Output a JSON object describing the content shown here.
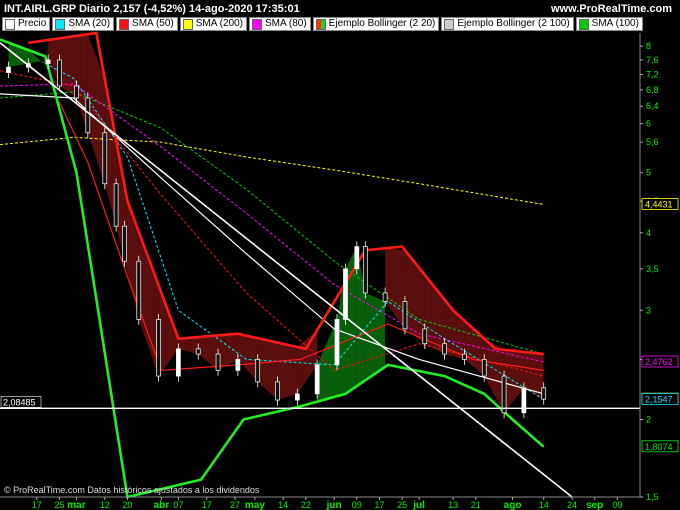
{
  "header": {
    "title": "INT.AIRL.GRP Diario 2,157 (-4,52%) 14-ago-2020 17:35:01",
    "site": "www.ProRealTime.com"
  },
  "legend": [
    {
      "label": "Precio",
      "color": "#ffffff",
      "icon": "box-swatch"
    },
    {
      "label": "SMA (20)",
      "color": "#00e5ff",
      "icon": "box-swatch"
    },
    {
      "label": "SMA (50)",
      "color": "#ff1111",
      "icon": "box-swatch"
    },
    {
      "label": "SMA (200)",
      "color": "#ffff00",
      "icon": "box-swatch"
    },
    {
      "label": "SMA (80)",
      "color": "#ff00ff",
      "icon": "box-swatch"
    },
    {
      "label": "Ejemplo Bollinger (2 20)",
      "color": "#ff3300",
      "icon": "split-swatch-red-green"
    },
    {
      "label": "Ejemplo Bollinger (2 100)",
      "color": "#cccccc",
      "icon": "box-swatch"
    },
    {
      "label": "SMA (100)",
      "color": "#00cc00",
      "icon": "box-swatch"
    }
  ],
  "footer": "© ProRealTime.com  Datos históricos ajustados a los dividendos",
  "colors": {
    "background": "#000000",
    "up_fill": "#0a6f0a",
    "down_fill": "#6b1010",
    "band_red": "#ff1a1a",
    "band_green": "#22ee22",
    "trendline": "#ffffff"
  },
  "chart_data": {
    "type": "candlestick",
    "scale": "log",
    "grid": false,
    "ylim": [
      1.5,
      8.4
    ],
    "y_ticks": [
      8,
      7.6,
      7.2,
      6.8,
      6.4,
      6,
      5.6,
      5,
      4.5,
      4,
      3.5,
      3,
      2.5,
      2,
      1.5
    ],
    "y_tick_labels": [
      "8",
      "7,6",
      "7,2",
      "6,8",
      "6,4",
      "6",
      "5,6",
      "5",
      "4,5",
      "4",
      "3,5",
      "3",
      "2,5",
      "2",
      "1,5"
    ],
    "x_ticks": [
      {
        "label": "17",
        "date": "2020-02-17"
      },
      {
        "label": "25",
        "date": "2020-02-25"
      },
      {
        "label": "mar",
        "date": "2020-03-02",
        "month": true
      },
      {
        "label": "12",
        "date": "2020-03-12"
      },
      {
        "label": "20",
        "date": "2020-03-20"
      },
      {
        "label": "abr",
        "date": "2020-04-01",
        "month": true
      },
      {
        "label": "07",
        "date": "2020-04-07"
      },
      {
        "label": "17",
        "date": "2020-04-17"
      },
      {
        "label": "27",
        "date": "2020-04-27"
      },
      {
        "label": "may",
        "date": "2020-05-04",
        "month": true
      },
      {
        "label": "14",
        "date": "2020-05-14"
      },
      {
        "label": "22",
        "date": "2020-05-22"
      },
      {
        "label": "jun",
        "date": "2020-06-01",
        "month": true
      },
      {
        "label": "09",
        "date": "2020-06-09"
      },
      {
        "label": "17",
        "date": "2020-06-17"
      },
      {
        "label": "25",
        "date": "2020-06-25"
      },
      {
        "label": "jul",
        "date": "2020-07-01",
        "month": true
      },
      {
        "label": "13",
        "date": "2020-07-13"
      },
      {
        "label": "21",
        "date": "2020-07-21"
      },
      {
        "label": "ago",
        "date": "2020-08-03",
        "month": true
      },
      {
        "label": "14",
        "date": "2020-08-14"
      },
      {
        "label": "24",
        "date": "2020-08-24"
      },
      {
        "label": "sep",
        "date": "2020-09-01",
        "month": true
      },
      {
        "label": "09",
        "date": "2020-09-09"
      }
    ],
    "price_labels": [
      {
        "value": 4.4431,
        "text": "4,4431",
        "color": "#ffff00"
      },
      {
        "value": 2.4762,
        "text": "2,4762",
        "color": "#ff00ff"
      },
      {
        "value": 2.157,
        "text": "2,157",
        "color": "#ffff00"
      },
      {
        "value": 2.1547,
        "text": "2,1547",
        "color": "#00e5ff"
      },
      {
        "value": 1.8074,
        "text": "1,8074",
        "color": "#00ee00"
      }
    ],
    "horizontal_line": {
      "value": 2.08485,
      "text": "2,08485"
    },
    "trendline": {
      "start": {
        "date": "2020-02-04",
        "value": 8.1
      },
      "end": {
        "date": "2020-08-24",
        "value": 1.5
      }
    },
    "close": [
      {
        "date": "2020-02-07",
        "value": 7.4
      },
      {
        "date": "2020-02-14",
        "value": 7.5
      },
      {
        "date": "2020-02-21",
        "value": 7.6
      },
      {
        "date": "2020-02-25",
        "value": 6.9
      },
      {
        "date": "2020-03-02",
        "value": 6.6
      },
      {
        "date": "2020-03-06",
        "value": 5.8
      },
      {
        "date": "2020-03-12",
        "value": 4.8
      },
      {
        "date": "2020-03-16",
        "value": 4.1
      },
      {
        "date": "2020-03-19",
        "value": 3.6
      },
      {
        "date": "2020-03-24",
        "value": 2.9
      },
      {
        "date": "2020-03-31",
        "value": 2.35
      },
      {
        "date": "2020-04-07",
        "value": 2.6
      },
      {
        "date": "2020-04-14",
        "value": 2.55
      },
      {
        "date": "2020-04-21",
        "value": 2.4
      },
      {
        "date": "2020-04-28",
        "value": 2.5
      },
      {
        "date": "2020-05-05",
        "value": 2.3
      },
      {
        "date": "2020-05-12",
        "value": 2.15
      },
      {
        "date": "2020-05-19",
        "value": 2.2
      },
      {
        "date": "2020-05-26",
        "value": 2.45
      },
      {
        "date": "2020-06-02",
        "value": 2.9
      },
      {
        "date": "2020-06-05",
        "value": 3.5
      },
      {
        "date": "2020-06-09",
        "value": 3.8
      },
      {
        "date": "2020-06-12",
        "value": 3.2
      },
      {
        "date": "2020-06-19",
        "value": 3.1
      },
      {
        "date": "2020-06-26",
        "value": 2.8
      },
      {
        "date": "2020-07-03",
        "value": 2.65
      },
      {
        "date": "2020-07-10",
        "value": 2.55
      },
      {
        "date": "2020-07-17",
        "value": 2.5
      },
      {
        "date": "2020-07-24",
        "value": 2.35
      },
      {
        "date": "2020-07-31",
        "value": 2.05
      },
      {
        "date": "2020-08-07",
        "value": 2.25
      },
      {
        "date": "2020-08-14",
        "value": 2.157
      }
    ],
    "series": [
      {
        "name": "SMA (200)",
        "color": "#ffff00",
        "dash": true,
        "values": [
          {
            "date": "2020-02-04",
            "value": 5.55
          },
          {
            "date": "2020-03-01",
            "value": 5.7
          },
          {
            "date": "2020-04-01",
            "value": 5.6
          },
          {
            "date": "2020-05-01",
            "value": 5.3
          },
          {
            "date": "2020-06-01",
            "value": 5.05
          },
          {
            "date": "2020-07-01",
            "value": 4.8
          },
          {
            "date": "2020-08-14",
            "value": 4.4431
          }
        ]
      },
      {
        "name": "SMA (100)",
        "color": "#00cc00",
        "dash": true,
        "values": [
          {
            "date": "2020-02-04",
            "value": 6.6
          },
          {
            "date": "2020-03-01",
            "value": 6.75
          },
          {
            "date": "2020-04-01",
            "value": 5.9
          },
          {
            "date": "2020-05-01",
            "value": 4.7
          },
          {
            "date": "2020-06-01",
            "value": 3.6
          },
          {
            "date": "2020-07-01",
            "value": 2.9
          },
          {
            "date": "2020-08-14",
            "value": 2.55
          }
        ]
      },
      {
        "name": "SMA (80)",
        "color": "#ff00ff",
        "dash": true,
        "values": [
          {
            "date": "2020-02-04",
            "value": 6.9
          },
          {
            "date": "2020-03-01",
            "value": 6.95
          },
          {
            "date": "2020-04-01",
            "value": 5.5
          },
          {
            "date": "2020-05-01",
            "value": 4.3
          },
          {
            "date": "2020-06-01",
            "value": 3.3
          },
          {
            "date": "2020-07-01",
            "value": 2.75
          },
          {
            "date": "2020-08-14",
            "value": 2.4762
          }
        ]
      },
      {
        "name": "SMA (50)",
        "color": "#ff1111",
        "dash": true,
        "values": [
          {
            "date": "2020-02-04",
            "value": 7.3
          },
          {
            "date": "2020-03-01",
            "value": 6.9
          },
          {
            "date": "2020-04-01",
            "value": 4.6
          },
          {
            "date": "2020-05-01",
            "value": 3.2
          },
          {
            "date": "2020-06-01",
            "value": 2.4
          },
          {
            "date": "2020-07-01",
            "value": 2.65
          },
          {
            "date": "2020-08-14",
            "value": 2.35
          }
        ]
      },
      {
        "name": "SMA (20)",
        "color": "#00e5ff",
        "dash": true,
        "values": [
          {
            "date": "2020-02-20",
            "value": 7.5
          },
          {
            "date": "2020-03-01",
            "value": 7.1
          },
          {
            "date": "2020-03-20",
            "value": 5.3
          },
          {
            "date": "2020-04-07",
            "value": 3.0
          },
          {
            "date": "2020-05-01",
            "value": 2.5
          },
          {
            "date": "2020-06-01",
            "value": 2.45
          },
          {
            "date": "2020-06-20",
            "value": 3.1
          },
          {
            "date": "2020-07-10",
            "value": 2.7
          },
          {
            "date": "2020-08-14",
            "value": 2.1547
          }
        ]
      },
      {
        "name": "Ejemplo Bollinger (2 100)",
        "color": "#ffffff",
        "dash": false,
        "values": [
          {
            "date": "2020-02-04",
            "value": 6.7
          },
          {
            "date": "2020-03-01",
            "value": 6.6
          },
          {
            "date": "2020-04-01",
            "value": 4.9
          },
          {
            "date": "2020-05-01",
            "value": 3.7
          },
          {
            "date": "2020-06-01",
            "value": 2.8
          },
          {
            "date": "2020-07-01",
            "value": 2.5
          },
          {
            "date": "2020-08-14",
            "value": 2.2
          }
        ]
      },
      {
        "name": "Ejemplo Bollinger (2 20)",
        "color": "#ff1a1a",
        "dash": false,
        "values": [
          {
            "date": "2020-02-25",
            "value": 6.5
          },
          {
            "date": "2020-03-06",
            "value": 5.2
          },
          {
            "date": "2020-03-20",
            "value": 3.4
          },
          {
            "date": "2020-04-01",
            "value": 2.4
          },
          {
            "date": "2020-04-28",
            "value": 2.45
          },
          {
            "date": "2020-05-20",
            "value": 2.5
          },
          {
            "date": "2020-06-20",
            "value": 2.85
          },
          {
            "date": "2020-07-20",
            "value": 2.5
          },
          {
            "date": "2020-08-14",
            "value": 2.4
          }
        ]
      }
    ],
    "bollinger_20": {
      "upper_color": "#ff1a1a",
      "lower_color": "#22ee22",
      "upper": [
        {
          "date": "2020-02-14",
          "value": 8.1
        },
        {
          "date": "2020-03-09",
          "value": 8.4
        },
        {
          "date": "2020-03-20",
          "value": 4.5
        },
        {
          "date": "2020-04-07",
          "value": 2.7
        },
        {
          "date": "2020-04-28",
          "value": 2.75
        },
        {
          "date": "2020-05-22",
          "value": 2.6
        },
        {
          "date": "2020-06-12",
          "value": 3.75
        },
        {
          "date": "2020-06-25",
          "value": 3.8
        },
        {
          "date": "2020-07-13",
          "value": 3.0
        },
        {
          "date": "2020-07-28",
          "value": 2.6
        },
        {
          "date": "2020-08-14",
          "value": 2.55
        }
      ],
      "lower": [
        {
          "date": "2020-02-04",
          "value": 8.2
        },
        {
          "date": "2020-02-20",
          "value": 7.7
        },
        {
          "date": "2020-03-02",
          "value": 5.0
        },
        {
          "date": "2020-03-20",
          "value": 1.5
        },
        {
          "date": "2020-04-15",
          "value": 1.6
        },
        {
          "date": "2020-04-30",
          "value": 2.0
        },
        {
          "date": "2020-05-20",
          "value": 2.1
        },
        {
          "date": "2020-06-05",
          "value": 2.2
        },
        {
          "date": "2020-06-20",
          "value": 2.45
        },
        {
          "date": "2020-07-10",
          "value": 2.35
        },
        {
          "date": "2020-07-24",
          "value": 2.2
        },
        {
          "date": "2020-08-03",
          "value": 2.0
        },
        {
          "date": "2020-08-14",
          "value": 1.8074
        }
      ]
    }
  }
}
